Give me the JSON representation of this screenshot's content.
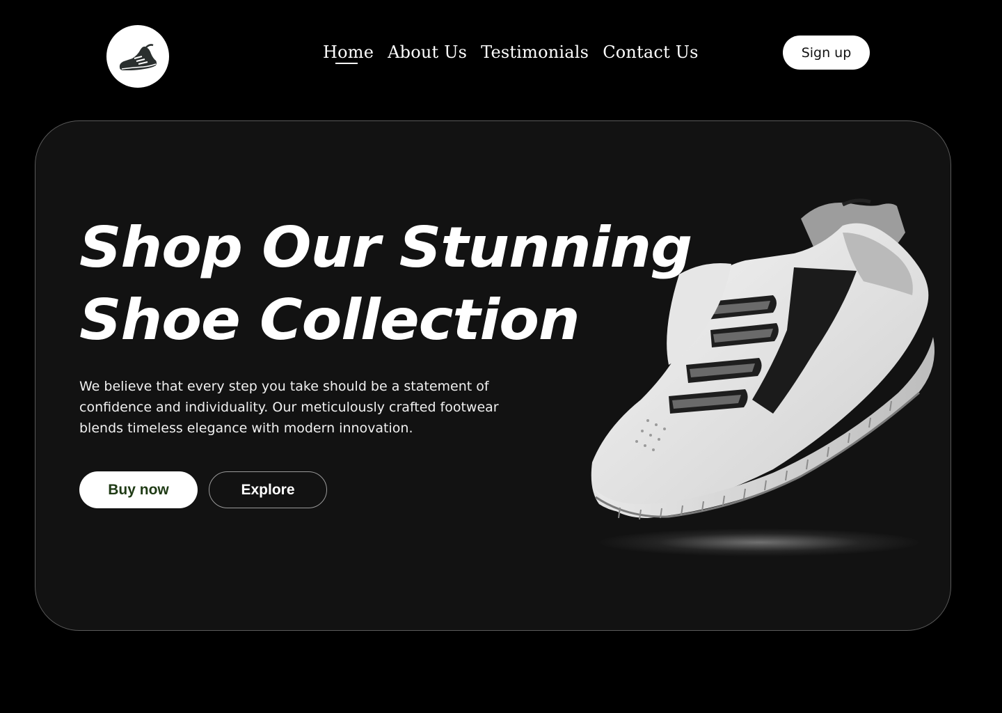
{
  "header": {
    "logo_icon": "running-shoe-icon",
    "nav": [
      {
        "label": "Home",
        "active": true
      },
      {
        "label": "About Us",
        "active": false
      },
      {
        "label": "Testimonials",
        "active": false
      },
      {
        "label": "Contact Us",
        "active": false
      }
    ],
    "signup_label": "Sign up"
  },
  "hero": {
    "headline_line1": "Shop Our Stunning",
    "headline_line2": "Shoe Collection",
    "description": "We believe that every step you take should be a statement of confidence and individuality. Our meticulously crafted footwear blends timeless elegance with modern innovation.",
    "buy_label": "Buy now",
    "explore_label": "Explore",
    "product_image": "white-sneaker-image"
  },
  "colors": {
    "background": "#000000",
    "card": "#121212",
    "buy_text": "#1e3a14"
  }
}
